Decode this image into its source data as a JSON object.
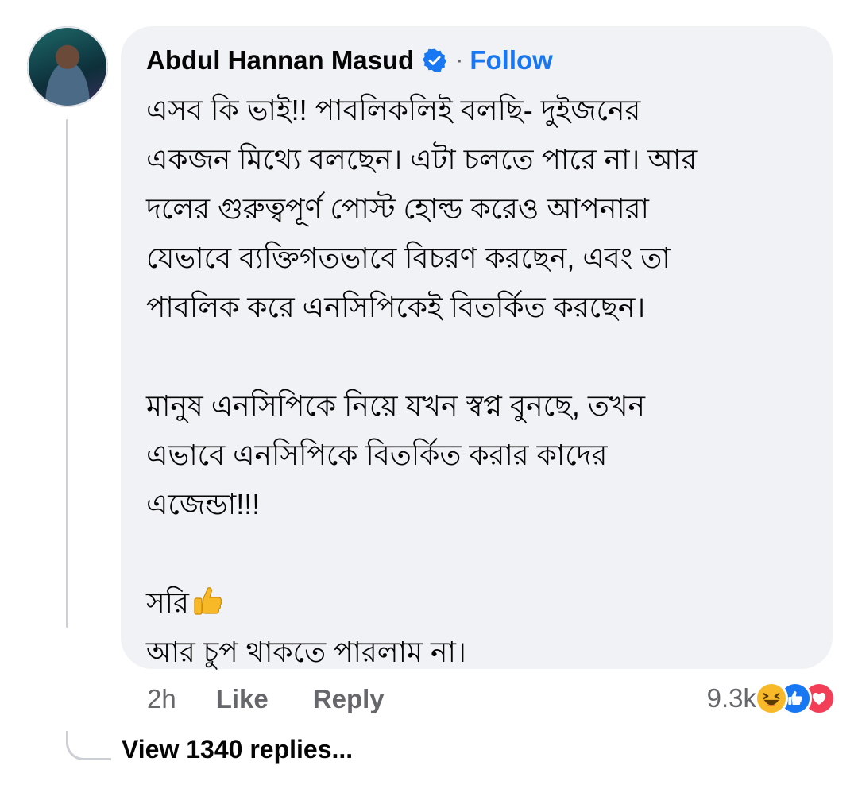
{
  "comment": {
    "author": "Abdul Hannan Masud",
    "separator": "·",
    "follow_label": "Follow",
    "paragraphs": [
      [
        "এসব কি ভাই!! পাবলিকলিই বলছি- দুইজনের",
        "একজন মিথ্যে বলছেন। এটা চলতে পারে না। আর",
        "দলের গুরুত্বপূর্ণ পোস্ট হোল্ড করেও আপনারা",
        "যেভাবে ব্যক্তিগতভাবে বিচরণ করছেন, এবং তা",
        "পাবলিক করে এনসিপিকেই বিতর্কিত করছেন।"
      ],
      [
        "মানুষ এনসিপিকে নিয়ে যখন স্বপ্ন বুনছে, তখন",
        "এভাবে এনসিপিকে বিতর্কিত করার কাদের",
        "এজেন্ডা!!!"
      ]
    ],
    "sorry_text": "সরি",
    "last_line": "আর চুপ থাকতে পারলাম না।"
  },
  "actions": {
    "time": "2h",
    "like_label": "Like",
    "reply_label": "Reply"
  },
  "reactions": {
    "count": "9.3k",
    "icons": [
      "haha-icon",
      "like-icon",
      "love-icon"
    ],
    "colors": {
      "haha": "#f7b928",
      "like": "#1877f2",
      "love": "#f33e58"
    }
  },
  "view_replies": "View 1340 replies...",
  "colors": {
    "accent": "#1877f2",
    "bubble": "#f0f2f5",
    "muted": "#65676b"
  }
}
